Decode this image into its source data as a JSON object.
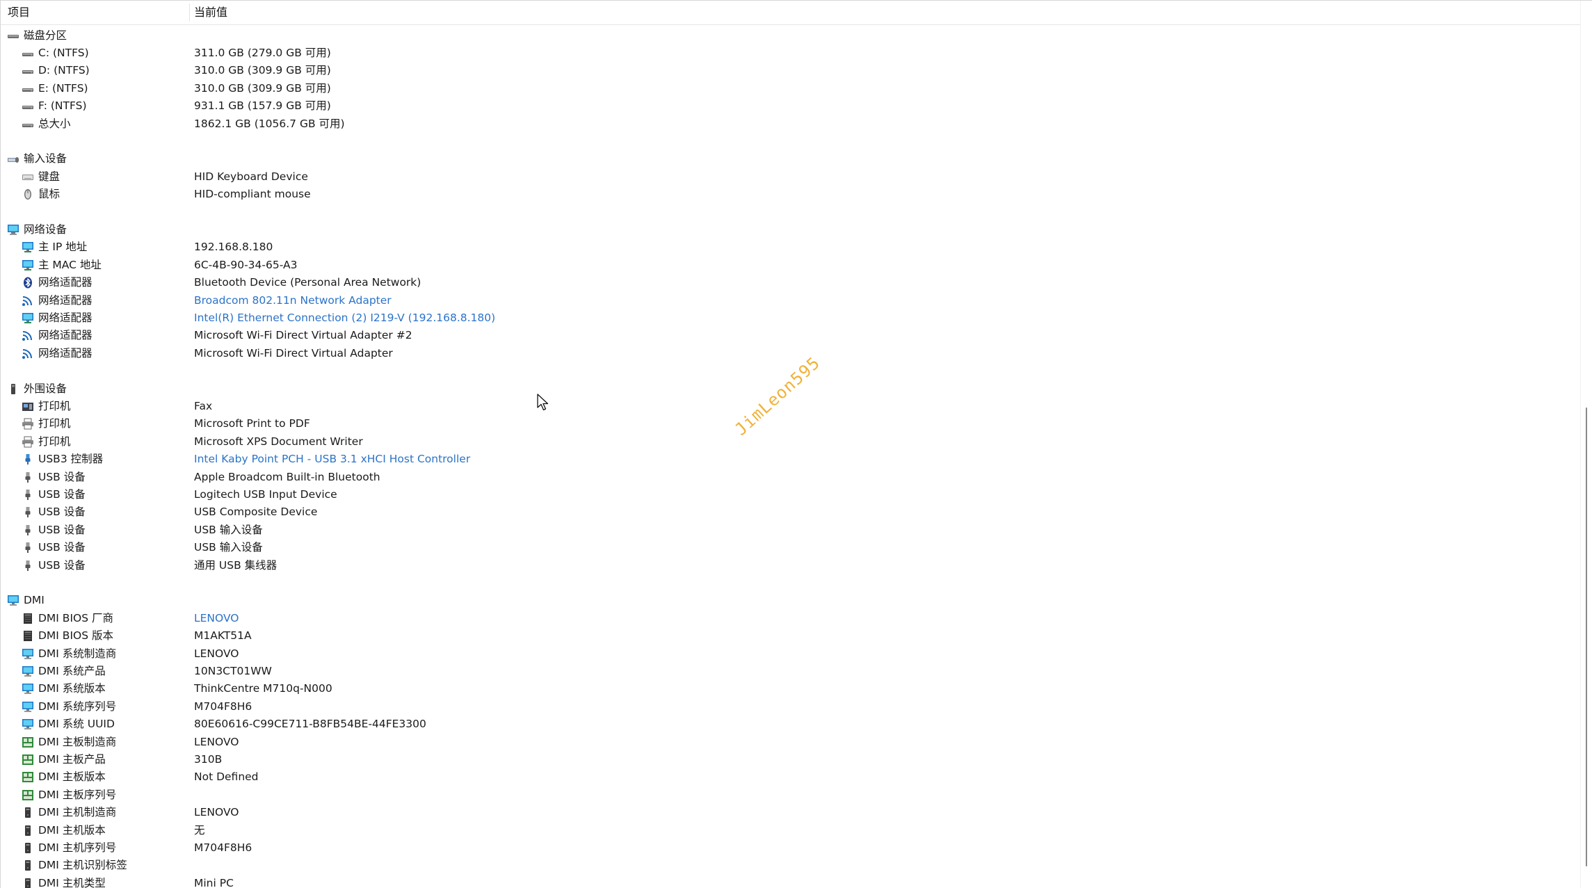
{
  "columns": {
    "item": "项目",
    "value": "当前值"
  },
  "colors": {
    "link": "#2b73c9",
    "watermark": "#f0b23a",
    "text": "#1a1a1a"
  },
  "watermark": "JimLeon595",
  "sections": [
    {
      "label": "磁盘分区",
      "icon": "drive-group-icon",
      "items": [
        {
          "label": "C: (NTFS)",
          "value": "311.0 GB (279.0 GB 可用)",
          "icon": "drive-icon"
        },
        {
          "label": "D: (NTFS)",
          "value": "310.0 GB (309.9 GB 可用)",
          "icon": "drive-icon"
        },
        {
          "label": "E: (NTFS)",
          "value": "310.0 GB (309.9 GB 可用)",
          "icon": "drive-icon"
        },
        {
          "label": "F: (NTFS)",
          "value": "931.1 GB (157.9 GB 可用)",
          "icon": "drive-icon"
        },
        {
          "label": "总大小",
          "value": "1862.1 GB (1056.7 GB 可用)",
          "icon": "drive-icon"
        }
      ]
    },
    {
      "label": "输入设备",
      "icon": "input-devices-icon",
      "items": [
        {
          "label": "键盘",
          "value": "HID Keyboard Device",
          "icon": "keyboard-icon"
        },
        {
          "label": "鼠标",
          "value": "HID-compliant mouse",
          "icon": "mouse-icon"
        }
      ]
    },
    {
      "label": "网络设备",
      "icon": "network-group-icon",
      "items": [
        {
          "label": "主 IP 地址",
          "value": "192.168.8.180",
          "icon": "monitor-network-icon"
        },
        {
          "label": "主 MAC 地址",
          "value": "6C-4B-90-34-65-A3",
          "icon": "monitor-network-icon"
        },
        {
          "label": "网络适配器",
          "value": "Bluetooth Device (Personal Area Network)",
          "icon": "bluetooth-icon"
        },
        {
          "label": "网络适配器",
          "value": "Broadcom 802.11n Network Adapter",
          "icon": "wifi-icon",
          "link": true
        },
        {
          "label": "网络适配器",
          "value": "Intel(R) Ethernet Connection (2) I219-V  (192.168.8.180)",
          "icon": "monitor-network-icon",
          "link": true
        },
        {
          "label": "网络适配器",
          "value": "Microsoft Wi-Fi Direct Virtual Adapter #2",
          "icon": "wifi-icon"
        },
        {
          "label": "网络适配器",
          "value": "Microsoft Wi-Fi Direct Virtual Adapter",
          "icon": "wifi-icon"
        }
      ]
    },
    {
      "label": "外围设备",
      "icon": "peripheral-group-icon",
      "items": [
        {
          "label": "打印机",
          "value": "Fax",
          "icon": "fax-icon"
        },
        {
          "label": "打印机",
          "value": "Microsoft Print to PDF",
          "icon": "printer-icon"
        },
        {
          "label": "打印机",
          "value": "Microsoft XPS Document Writer",
          "icon": "printer-icon"
        },
        {
          "label": "USB3 控制器",
          "value": "Intel Kaby Point PCH - USB 3.1 xHCI Host Controller",
          "icon": "usb-controller-icon",
          "link": true
        },
        {
          "label": "USB 设备",
          "value": "Apple Broadcom Built-in Bluetooth",
          "icon": "usb-plug-icon"
        },
        {
          "label": "USB 设备",
          "value": "Logitech USB Input Device",
          "icon": "usb-plug-icon"
        },
        {
          "label": "USB 设备",
          "value": "USB Composite Device",
          "icon": "usb-plug-icon"
        },
        {
          "label": "USB 设备",
          "value": "USB 输入设备",
          "icon": "usb-plug-icon"
        },
        {
          "label": "USB 设备",
          "value": "USB 输入设备",
          "icon": "usb-plug-icon"
        },
        {
          "label": "USB 设备",
          "value": "通用 USB 集线器",
          "icon": "usb-plug-icon"
        }
      ]
    },
    {
      "label": "DMI",
      "icon": "dmi-group-icon",
      "items": [
        {
          "label": "DMI BIOS 厂商",
          "value": "LENOVO",
          "icon": "bios-chip-icon",
          "link": true
        },
        {
          "label": "DMI BIOS 版本",
          "value": "M1AKT51A",
          "icon": "bios-chip-icon"
        },
        {
          "label": "DMI 系统制造商",
          "value": "LENOVO",
          "icon": "monitor-icon"
        },
        {
          "label": "DMI 系统产品",
          "value": "10N3CT01WW",
          "icon": "monitor-icon"
        },
        {
          "label": "DMI 系统版本",
          "value": "ThinkCentre M710q-N000",
          "icon": "monitor-icon"
        },
        {
          "label": "DMI 系统序列号",
          "value": "M704F8H6",
          "icon": "monitor-icon"
        },
        {
          "label": "DMI 系统 UUID",
          "value": "80E60616-C99CE711-B8FB54BE-44FE3300",
          "icon": "monitor-icon"
        },
        {
          "label": "DMI 主板制造商",
          "value": "LENOVO",
          "icon": "motherboard-icon"
        },
        {
          "label": "DMI 主板产品",
          "value": "310B",
          "icon": "motherboard-icon"
        },
        {
          "label": "DMI 主板版本",
          "value": "Not Defined",
          "icon": "motherboard-icon"
        },
        {
          "label": "DMI 主板序列号",
          "value": "",
          "icon": "motherboard-icon"
        },
        {
          "label": "DMI 主机制造商",
          "value": "LENOVO",
          "icon": "chassis-icon"
        },
        {
          "label": "DMI 主机版本",
          "value": "无",
          "icon": "chassis-icon"
        },
        {
          "label": "DMI 主机序列号",
          "value": "M704F8H6",
          "icon": "chassis-icon"
        },
        {
          "label": "DMI 主机识别标签",
          "value": "",
          "icon": "chassis-icon"
        },
        {
          "label": "DMI 主机类型",
          "value": "Mini PC",
          "icon": "chassis-icon"
        }
      ]
    }
  ]
}
